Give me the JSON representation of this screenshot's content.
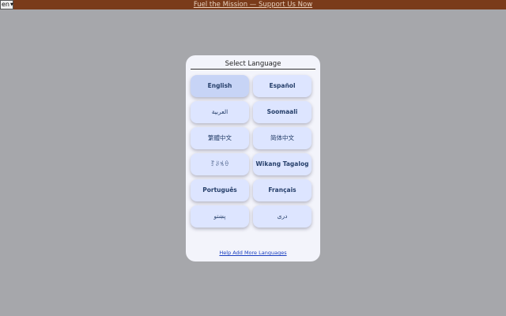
{
  "banner": {
    "text": "Fuel the Mission — Support Us Now"
  },
  "locale_select": {
    "value": "en"
  },
  "modal": {
    "title": "Select Language",
    "languages": [
      {
        "label": "English"
      },
      {
        "label": "Español"
      },
      {
        "label": "العربية"
      },
      {
        "label": "Soomaali"
      },
      {
        "label": "繁體中文"
      },
      {
        "label": "简体中文"
      },
      {
        "label": "ꆈꌠꁱꂷ"
      },
      {
        "label": "Wikang Tagalog"
      },
      {
        "label": "Português"
      },
      {
        "label": "Français"
      },
      {
        "label": "پښتو"
      },
      {
        "label": "دری"
      }
    ],
    "help_link": "Help Add More Languages"
  },
  "colors": {
    "banner_bg": "#7a3b1a",
    "page_bg": "#a6a7ab",
    "button_bg": "#dde5ff",
    "button_active_bg": "#c7d4f6",
    "button_text": "#27406b",
    "link": "#1a3fc0"
  }
}
